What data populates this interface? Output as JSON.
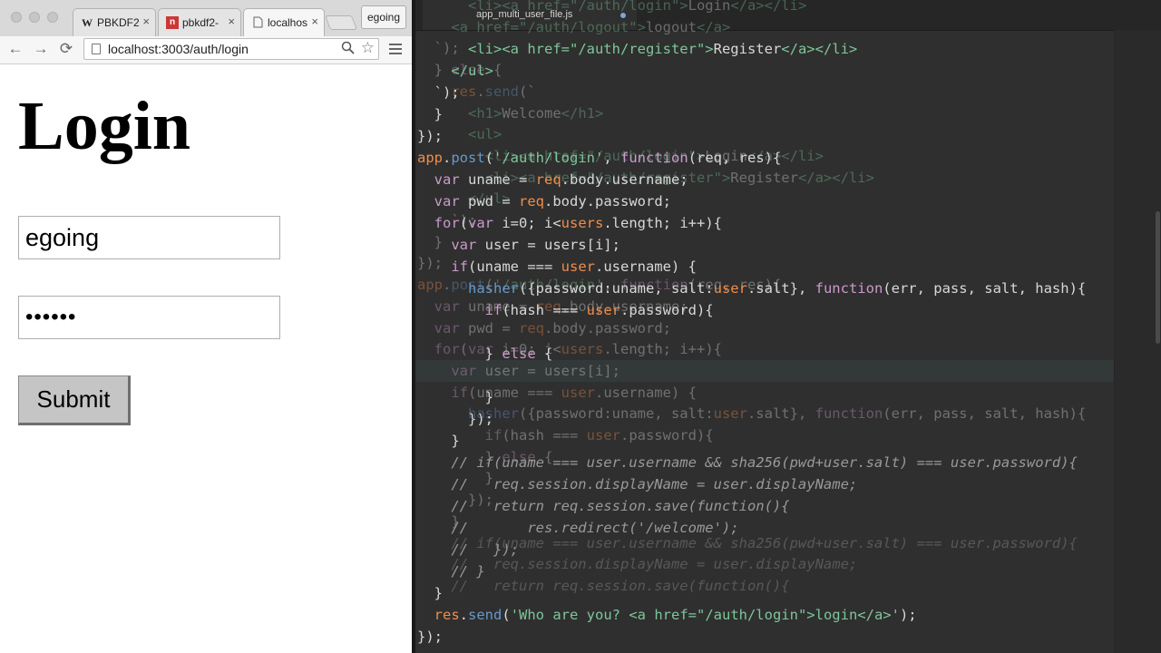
{
  "browser": {
    "tabs": [
      {
        "favicon": "wikipedia-favicon",
        "title": "PBKDF2",
        "close": "×"
      },
      {
        "favicon": "npm-favicon",
        "title": "pbkdf2-",
        "close": "×"
      },
      {
        "favicon": "page-icon",
        "title": "localhos",
        "close": "×"
      }
    ],
    "profile_name": "egoing",
    "url": "localhost:3003/auth/login",
    "nav": {
      "back": "←",
      "forward": "→",
      "reload": "⟳"
    }
  },
  "page": {
    "heading": "Login",
    "username_value": "egoing",
    "password_value": "••••••",
    "submit_label": "Submit"
  },
  "editor": {
    "file_name": "app_multi_user_file.js",
    "modified": true,
    "ghost_lines": [
      "      <li><a href=\"/auth/login\">Login</a></li>",
      "    <a href=\"/auth/logout\">logout</a>",
      "  `);",
      "  } else {",
      "    res.send(`",
      "      <h1>Welcome</h1>",
      "      <ul>",
      "        <li><a href=\"/auth/login\">Login</a></li>",
      "        <li><a href=\"/auth/register\">Register</a></li>",
      "      </ul>",
      "    `);",
      "  }",
      "});",
      "app.post('/auth/login', function(req, res){",
      "  var uname = req.body.username;",
      "  var pwd = req.body.password;",
      "  for(var i=0; i<users.length; i++){",
      "    var user = users[i];",
      "    if(uname === user.username) {",
      "      hasher({password:uname, salt:user.salt}, function(err, pass, salt, hash){",
      "        if(hash === user.password){",
      "        } else {",
      "        }",
      "      });",
      "    }",
      "    // if(uname === user.username && sha256(pwd+user.salt) === user.password){",
      "    //   req.session.displayName = user.displayName;",
      "    //   return req.session.save(function(){"
    ],
    "main_lines": [
      "      <li><a href=\"/auth/register\">Register</a></li>",
      "    </ul>",
      "  `);",
      "  }",
      "});",
      "app.post('/auth/login', function(req, res){",
      "  var uname = req.body.username;",
      "  var pwd = req.body.password;",
      "  for(var i=0; i<users.length; i++){",
      "    var user = users[i];",
      "    if(uname === user.username) {",
      "      hasher({password:uname, salt:user.salt}, function(err, pass, salt, hash){",
      "        if(hash === user.password){",
      "",
      "        } else {",
      "",
      "        }",
      "      });",
      "    }",
      "    // if(uname === user.username && sha256(pwd+user.salt) === user.password){",
      "    //   req.session.displayName = user.displayName;",
      "    //   return req.session.save(function(){",
      "    //       res.redirect('/welcome');",
      "    //   });",
      "    // }",
      "  }",
      "  res.send('Who are you? <a href=\"/auth/login\">login</a>');",
      "});"
    ]
  },
  "colors": {
    "editor_bg": "#2f2f2f",
    "keyword": "#cc99cd",
    "string": "#7ec699",
    "function": "#6699cc",
    "comment": "#999999",
    "property": "#f08d49",
    "tab_dot": "#7aa6da"
  }
}
